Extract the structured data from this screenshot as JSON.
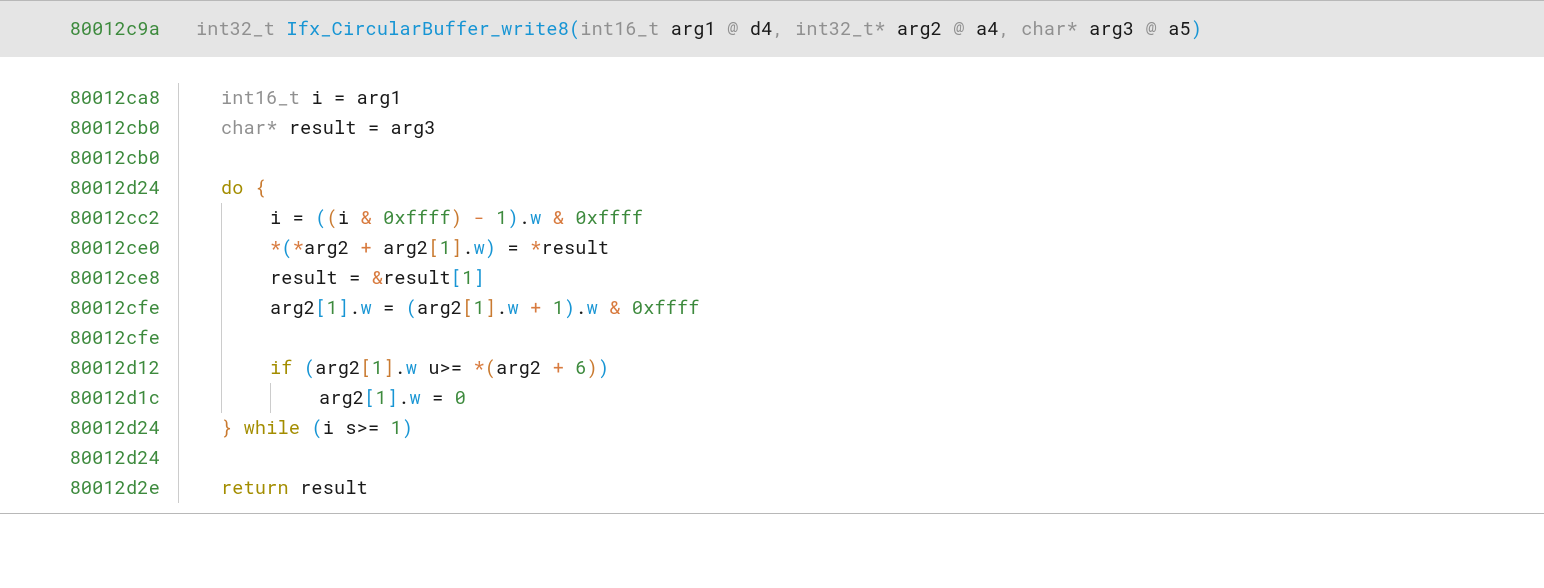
{
  "signature": {
    "addr": "80012c9a",
    "ret_type": "int32_t",
    "func_name": "Ifx_CircularBuffer_write8",
    "p1_type": "int16_t",
    "p1_name": "arg1",
    "p1_reg": "d4",
    "p2_type": "int32_t*",
    "p2_name": "arg2",
    "p2_reg": "a4",
    "p3_type": "char*",
    "p3_name": "arg3",
    "p3_reg": "a5",
    "at": "@",
    "comma": ","
  },
  "lines": {
    "l1_addr": "80012ca8",
    "l2_addr": "80012cb0",
    "l3_addr": "80012cb0",
    "l4_addr": "80012d24",
    "l5_addr": "80012cc2",
    "l6_addr": "80012ce0",
    "l7_addr": "80012ce8",
    "l8_addr": "80012cfe",
    "l9_addr": "80012cfe",
    "l10_addr": "80012d12",
    "l11_addr": "80012d1c",
    "l12_addr": "80012d24",
    "l13_addr": "80012d24",
    "l14_addr": "80012d2e"
  },
  "tokens": {
    "int16_t": "int16_t",
    "int32_t": "int32_t",
    "int32_t_ptr": "int32_t*",
    "char_ptr": "char*",
    "i": "i",
    "arg1": "arg1",
    "arg2": "arg2",
    "arg3": "arg3",
    "result": "result",
    "do": "do",
    "if": "if",
    "while": "while",
    "return": "return",
    "hex_ffff": "0xffff",
    "one": "1",
    "six": "6",
    "zero": "0",
    "w": "w",
    "eq": " = ",
    "amp": "&",
    "minus": "-",
    "plus": "+",
    "star": "*",
    "dot": ".",
    "uge": "u>=",
    "sge": "s>=",
    "lparen": "(",
    "rparen": ")",
    "lbrace": "{",
    "rbrace": "}",
    "lbracket": "[",
    "rbracket": "]",
    "space": " "
  }
}
